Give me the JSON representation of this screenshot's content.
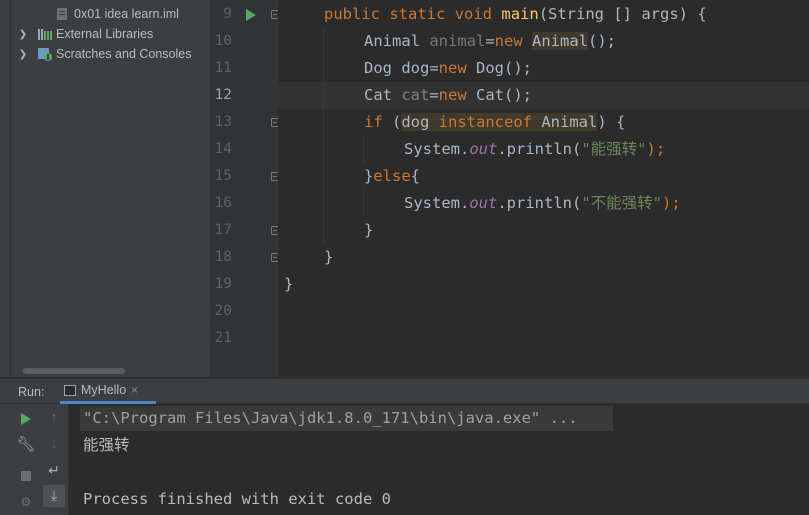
{
  "project_tree": {
    "items": [
      {
        "label": "0x01 idea learn.iml",
        "icon": "module-file-icon"
      },
      {
        "label": "External Libraries",
        "icon": "libraries-icon"
      },
      {
        "label": "Scratches and Consoles",
        "icon": "scratches-icon"
      }
    ]
  },
  "gutter": {
    "line_numbers": [
      "9",
      "10",
      "11",
      "12",
      "13",
      "14",
      "15",
      "16",
      "17",
      "18",
      "19",
      "20",
      "21"
    ],
    "current_line": "12"
  },
  "editor": {
    "lines": [
      [
        "public",
        "static",
        "void",
        "main",
        "(String [] args) {"
      ],
      [
        "Animal ",
        "animal",
        "=",
        "new",
        " ",
        "Animal",
        "();"
      ],
      [
        "Dog dog=",
        "new",
        " Dog();"
      ],
      [
        "Cat ",
        "cat",
        "=",
        "new",
        " Cat();"
      ],
      [
        "if",
        " (",
        "dog ",
        "instanceof",
        " Animal",
        ") {"
      ],
      [
        "System.",
        "out",
        ".println(",
        "\"能强转\"",
        ");"
      ],
      [
        "}",
        "else",
        "{"
      ],
      [
        "System.",
        "out",
        ".println(",
        "\"不能强转\"",
        ");"
      ],
      [
        "}"
      ],
      [
        "}"
      ],
      [
        "}"
      ]
    ]
  },
  "run_panel": {
    "title": "Run:",
    "tab_label": "MyHello",
    "tab_close": "×",
    "toolbar_icons": [
      "run-icon",
      "wrench-icon",
      "stop-icon",
      "up-arrow-icon",
      "down-arrow-icon",
      "soft-wrap-icon",
      "scroll-to-end-icon"
    ]
  },
  "console": {
    "command": "\"C:\\Program Files\\Java\\jdk1.8.0_171\\bin\\java.exe\" ...",
    "output": "能强转",
    "finish": "Process finished with exit code 0"
  },
  "colors": {
    "keyword": "#cc7832",
    "function": "#ffc66d",
    "string": "#6a8759",
    "field": "#9876aa",
    "run_green": "#59a869",
    "tab_underline": "#4a88c7"
  }
}
